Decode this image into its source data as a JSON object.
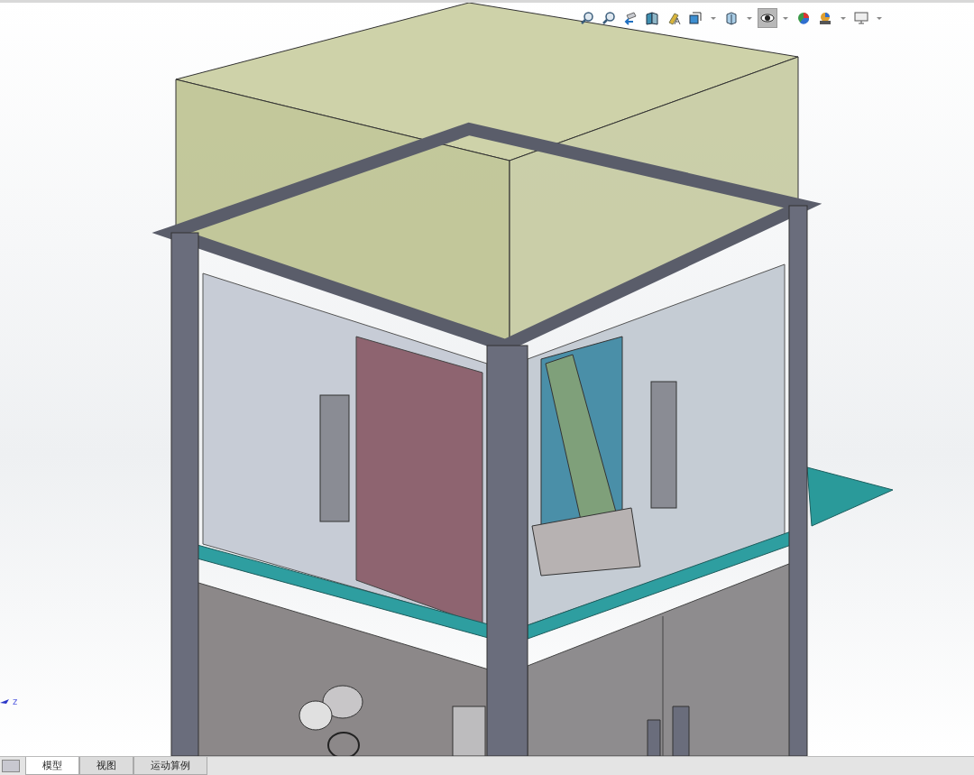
{
  "heads_up_toolbar": [
    {
      "kind": "zoom-fit",
      "selected": false
    },
    {
      "kind": "zoom-area",
      "selected": false
    },
    {
      "kind": "previous-view",
      "selected": false
    },
    {
      "kind": "section-view",
      "selected": false
    },
    {
      "kind": "dynamic-annotation",
      "selected": false
    },
    {
      "kind": "view-orientation",
      "selected": false,
      "dropdown": true
    },
    {
      "kind": "display-style",
      "selected": false,
      "dropdown": true
    },
    {
      "kind": "hide-show",
      "selected": true,
      "dropdown": true
    },
    {
      "kind": "edit-appearance",
      "selected": false
    },
    {
      "kind": "scene",
      "selected": false,
      "dropdown": true
    },
    {
      "kind": "display-settings",
      "selected": false,
      "dropdown": true
    }
  ],
  "triad": {
    "axis_label": "z"
  },
  "bottom_tabs": [
    {
      "label": "模型",
      "selected": true
    },
    {
      "label": "视图",
      "selected": false
    },
    {
      "label": "运动算例",
      "selected": false
    }
  ]
}
